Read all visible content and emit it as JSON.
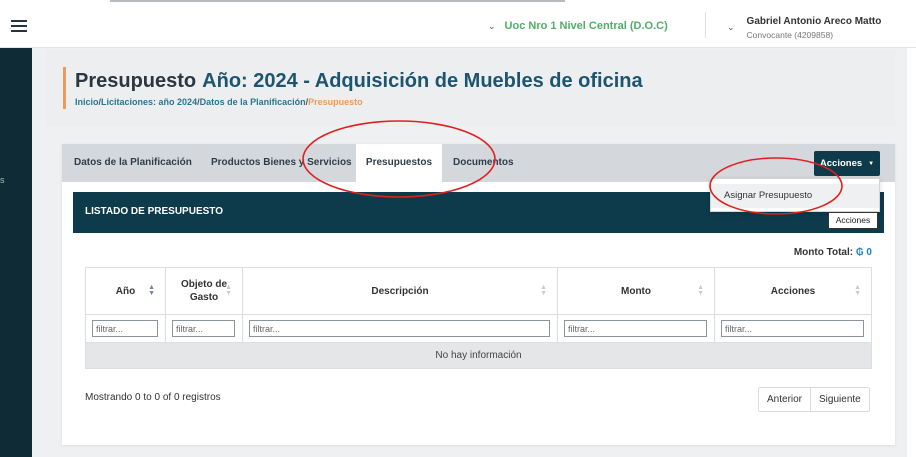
{
  "topbar": {
    "unit_label": "Uoc Nro 1 Nivel Central (D.O.C)",
    "user_name": "Gabriel Antonio Areco Matto",
    "user_role": "Convocante (4209858)",
    "accent": "#4fae67"
  },
  "page": {
    "title": "Presupuesto",
    "title_year": "Año: 2024 - Adquisición de Muebles de oficina",
    "breadcrumb": [
      "Inicio",
      "Licitaciones: año 2024",
      "Datos de la Planificación",
      "Presupuesto"
    ]
  },
  "tabs": [
    {
      "label": "Datos de la Planificación",
      "active": false
    },
    {
      "label": "Productos Bienes y Servicios",
      "active": false
    },
    {
      "label": "Presupuestos",
      "active": true
    },
    {
      "label": "Documentos",
      "active": false
    }
  ],
  "actions_button": "Acciones",
  "dropdown": {
    "item": "Asignar Presupuesto",
    "tooltip": "Acciones"
  },
  "panel": {
    "title": "LISTADO DE PRESUPUESTO",
    "monto_label": "Monto Total:",
    "monto_value": "₲ 0",
    "columns": [
      "Año",
      "Objeto de Gasto",
      "Descripción",
      "Monto",
      "Acciones"
    ],
    "filter_placeholder": "filtrar...",
    "empty_text": "No hay información",
    "showing": "Mostrando 0 to 0 of 0 registros",
    "prev": "Anterior",
    "next": "Siguiente"
  },
  "colors": {
    "primary": "#0e3b4c",
    "highlight": "#ea9b5a",
    "annotation": "#e02020"
  }
}
